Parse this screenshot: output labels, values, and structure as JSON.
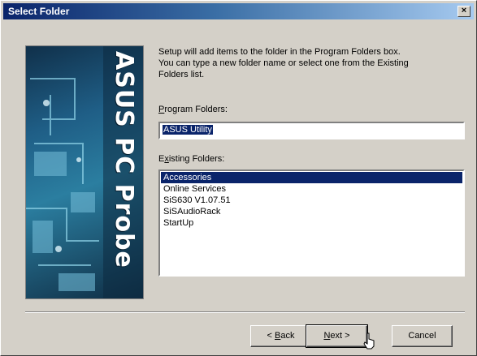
{
  "window": {
    "title": "Select Folder",
    "close_label": "×"
  },
  "sidebar": {
    "art_text": "ASUS PC Probe"
  },
  "instructions": {
    "line1": "Setup will add items to the folder in the Program Folders box.",
    "line2": "You can type a new folder name or select one from the Existing",
    "line3": "Folders list."
  },
  "program_folders": {
    "label_prefix": "",
    "label_underline": "P",
    "label_rest": "rogram Folders:",
    "value": "ASUS Utility"
  },
  "existing_folders": {
    "label_prefix": "E",
    "label_underline": "x",
    "label_rest": "isting Folders:",
    "items": [
      "Accessories",
      "Online Services",
      "SiS630 V1.07.51",
      "SiSAudioRack",
      "StartUp"
    ],
    "selected_index": 0
  },
  "buttons": {
    "back_prefix": "< ",
    "back_underline": "B",
    "back_rest": "ack",
    "next_underline": "N",
    "next_rest": "ext >",
    "cancel": "Cancel"
  },
  "colors": {
    "title_start": "#0a246a",
    "title_end": "#a6caf0",
    "dialog_bg": "#d4d0c8",
    "selection": "#0a246a"
  }
}
